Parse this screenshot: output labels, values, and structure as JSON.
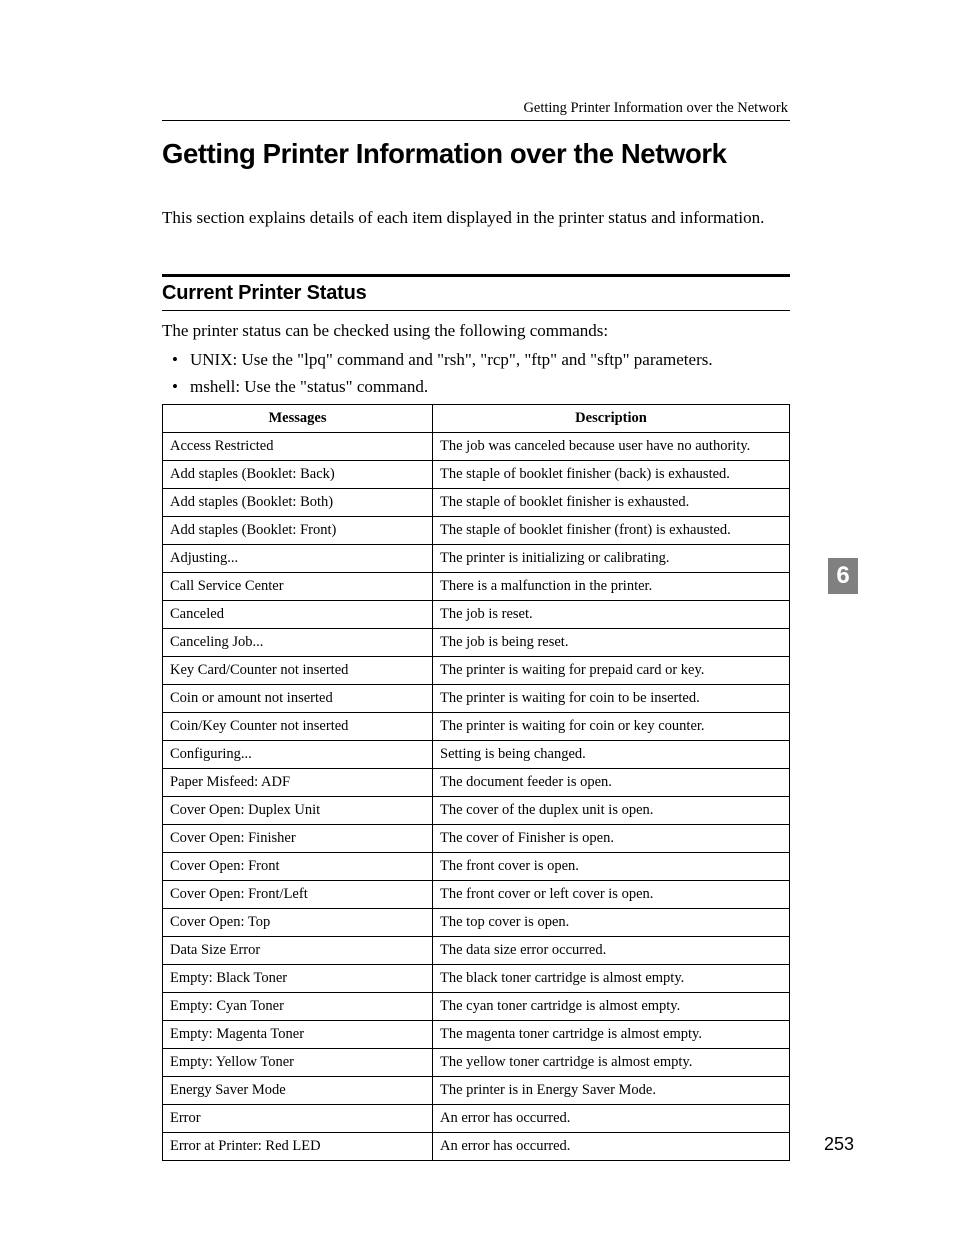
{
  "running_header": "Getting Printer Information over the Network",
  "title": "Getting Printer Information over the Network",
  "intro": "This section explains details of each item displayed in the printer status and information.",
  "subheading": "Current Printer Status",
  "status_desc": "The printer status can be checked using the following commands:",
  "bullets": [
    "UNIX: Use the \"lpq\" command and \"rsh\", \"rcp\", \"ftp\" and \"sftp\" parameters.",
    "mshell: Use the \"status\" command."
  ],
  "table": {
    "header": [
      "Messages",
      "Description"
    ],
    "rows": [
      [
        "Access Restricted",
        "The job was canceled because user have no authority."
      ],
      [
        "Add staples (Booklet: Back)",
        "The staple of booklet finisher (back) is exhausted."
      ],
      [
        "Add staples (Booklet: Both)",
        "The staple of booklet finisher is exhausted."
      ],
      [
        "Add staples (Booklet: Front)",
        "The staple of booklet finisher (front) is exhausted."
      ],
      [
        "Adjusting...",
        "The printer is initializing or calibrating."
      ],
      [
        "Call Service Center",
        "There is a malfunction in the printer."
      ],
      [
        "Canceled",
        "The job is reset."
      ],
      [
        "Canceling Job...",
        "The job is being reset."
      ],
      [
        "Key Card/Counter not inserted",
        "The printer is waiting for prepaid card or key."
      ],
      [
        "Coin or amount not inserted",
        "The printer is waiting for coin to be inserted."
      ],
      [
        "Coin/Key Counter not inserted",
        "The printer is waiting for coin or key counter."
      ],
      [
        "Configuring...",
        "Setting is being changed."
      ],
      [
        "Paper Misfeed: ADF",
        "The document feeder is open."
      ],
      [
        "Cover Open: Duplex Unit",
        "The cover of the duplex unit is open."
      ],
      [
        "Cover Open: Finisher",
        "The cover of Finisher is open."
      ],
      [
        "Cover Open: Front",
        "The front cover is open."
      ],
      [
        "Cover Open: Front/Left",
        "The front cover or left cover is open."
      ],
      [
        "Cover Open: Top",
        "The top cover is open."
      ],
      [
        "Data Size Error",
        "The data size error occurred."
      ],
      [
        "Empty: Black Toner",
        "The black toner cartridge is almost empty."
      ],
      [
        "Empty: Cyan Toner",
        "The cyan toner cartridge is almost empty."
      ],
      [
        "Empty: Magenta Toner",
        "The magenta toner cartridge is almost empty."
      ],
      [
        "Empty: Yellow Toner",
        "The yellow toner cartridge is almost empty."
      ],
      [
        "Energy Saver Mode",
        "The printer is in Energy Saver Mode."
      ],
      [
        "Error",
        "An error has occurred."
      ],
      [
        "Error at Printer: Red LED",
        "An error has occurred."
      ]
    ]
  },
  "page_tab": "6",
  "page_number": "253"
}
